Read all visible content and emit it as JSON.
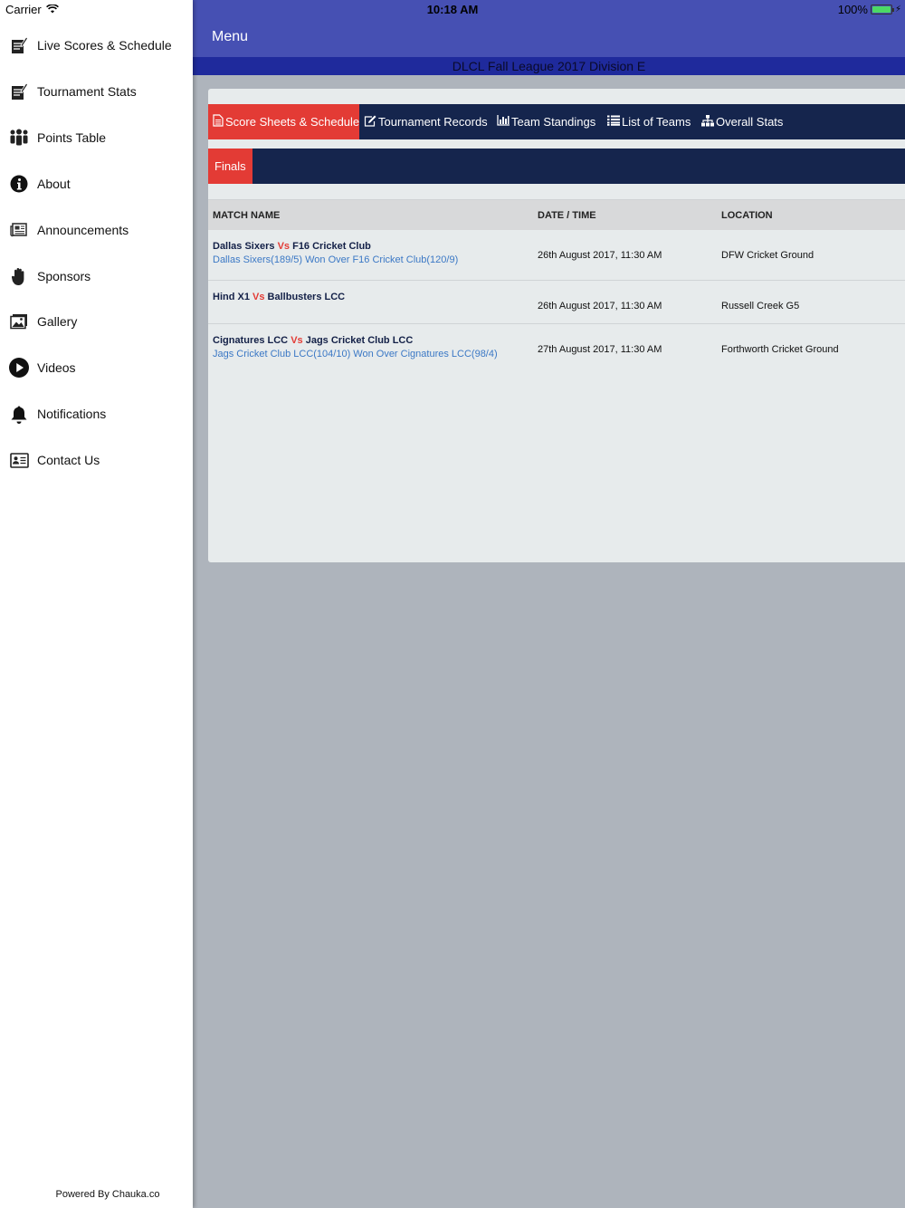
{
  "status_bar": {
    "carrier": "Carrier",
    "time": "10:18 AM",
    "battery": "100%"
  },
  "sidebar": {
    "items": [
      {
        "label": "Live Scores & Schedule",
        "icon": "scoresheet-icon"
      },
      {
        "label": "Tournament Stats",
        "icon": "stats-icon"
      },
      {
        "label": "Points Table",
        "icon": "team-icon"
      },
      {
        "label": "About",
        "icon": "info-icon"
      },
      {
        "label": "Announcements",
        "icon": "newspaper-icon"
      },
      {
        "label": "Sponsors",
        "icon": "hand-icon"
      },
      {
        "label": "Gallery",
        "icon": "image-icon"
      },
      {
        "label": "Videos",
        "icon": "play-icon"
      },
      {
        "label": "Notifications",
        "icon": "bell-icon"
      },
      {
        "label": "Contact Us",
        "icon": "contact-card-icon"
      }
    ],
    "powered_by": "Powered By Chauka.co"
  },
  "header": {
    "title": "Menu",
    "league": "DLCL Fall League 2017 Division E"
  },
  "colors": {
    "header": "#4650b3",
    "tabbar": "#15254d",
    "accent_red": "#e33b35",
    "result_blue": "#3b78c5"
  },
  "tabs": [
    {
      "label": "Score Sheets & Schedule",
      "icon": "file-icon",
      "active": true
    },
    {
      "label": "Tournament Records",
      "icon": "edit-icon",
      "active": false
    },
    {
      "label": "Team Standings",
      "icon": "bar-chart-icon",
      "active": false
    },
    {
      "label": "List of Teams",
      "icon": "list-icon",
      "active": false
    },
    {
      "label": "Overall Stats",
      "icon": "sitemap-icon",
      "active": false
    }
  ],
  "subtabs": [
    {
      "label": "Finals",
      "active": true
    }
  ],
  "table": {
    "headers": {
      "match": "MATCH NAME",
      "date": "DATE / TIME",
      "location": "LOCATION"
    },
    "rows": [
      {
        "team1": "Dallas Sixers",
        "vs": "Vs",
        "team2": "F16 Cricket Club",
        "result": "Dallas Sixers(189/5) Won Over F16 Cricket Club(120/9)",
        "date": "26th August 2017, 11:30 AM",
        "location": "DFW Cricket Ground"
      },
      {
        "team1": "Hind X1",
        "vs": "Vs",
        "team2": "Ballbusters LCC",
        "result": "",
        "date": "26th August 2017, 11:30 AM",
        "location": "Russell Creek G5"
      },
      {
        "team1": "Cignatures LCC",
        "vs": "Vs",
        "team2": "Jags Cricket Club LCC",
        "result": "Jags Cricket Club LCC(104/10) Won Over Cignatures LCC(98/4)",
        "date": "27th August 2017, 11:30 AM",
        "location": "Forthworth Cricket Ground"
      }
    ]
  }
}
